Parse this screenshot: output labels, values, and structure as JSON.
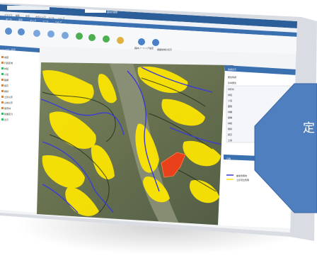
{
  "browser": {
    "tabs": [
      "",
      "森林計画図"
    ],
    "menu": [
      "ファイル",
      "編集",
      "表示",
      "お気に入り",
      "ツール",
      "ヘルプ"
    ]
  },
  "ribbon": {
    "tabs": [
      "ホーム",
      "表示",
      "マップ",
      "ツール",
      "ヘルプ"
    ],
    "buttons": [
      "",
      "",
      "",
      "",
      "",
      "",
      "",
      "",
      "",
      ""
    ],
    "right_buttons": [
      "森林ゾーニング設定",
      "保護地域の表示"
    ]
  },
  "sidebar": {
    "header": "レイヤー表示",
    "items": [
      "地図",
      "行政区域",
      "林班",
      "小班",
      "路網",
      "標高",
      "傾斜",
      "土砂災害",
      "山地災害",
      "保安林",
      "施業区分",
      "表示"
    ]
  },
  "panel": {
    "header": "情報表示",
    "sub_header": "属性情報",
    "section_title": "基本属性",
    "rows": [
      {
        "label": "市町村",
        "value": ""
      },
      {
        "label": "林班",
        "value": ""
      },
      {
        "label": "小班",
        "value": ""
      },
      {
        "label": "面積",
        "value": ""
      },
      {
        "label": "林種",
        "value": ""
      },
      {
        "label": "樹種",
        "value": ""
      },
      {
        "label": "林齢",
        "value": ""
      },
      {
        "label": "傾斜",
        "value": ""
      },
      {
        "label": "標高",
        "value": ""
      },
      {
        "label": "土壌",
        "value": ""
      }
    ],
    "legend_header": "凡例",
    "legend_items": [
      {
        "label": "崩壊危険地",
        "color": "#3b3bd6"
      },
      {
        "label": "土砂流出危険",
        "color": "#ffe800"
      }
    ]
  },
  "callout": {
    "text": "定",
    "color": "#4f7fbf"
  },
  "map": {
    "hazard_color": "#ffe800",
    "stream_color": "#3b3bd6",
    "highlight_color": "#e8401a",
    "terrain_color": "#6d7a5a"
  }
}
